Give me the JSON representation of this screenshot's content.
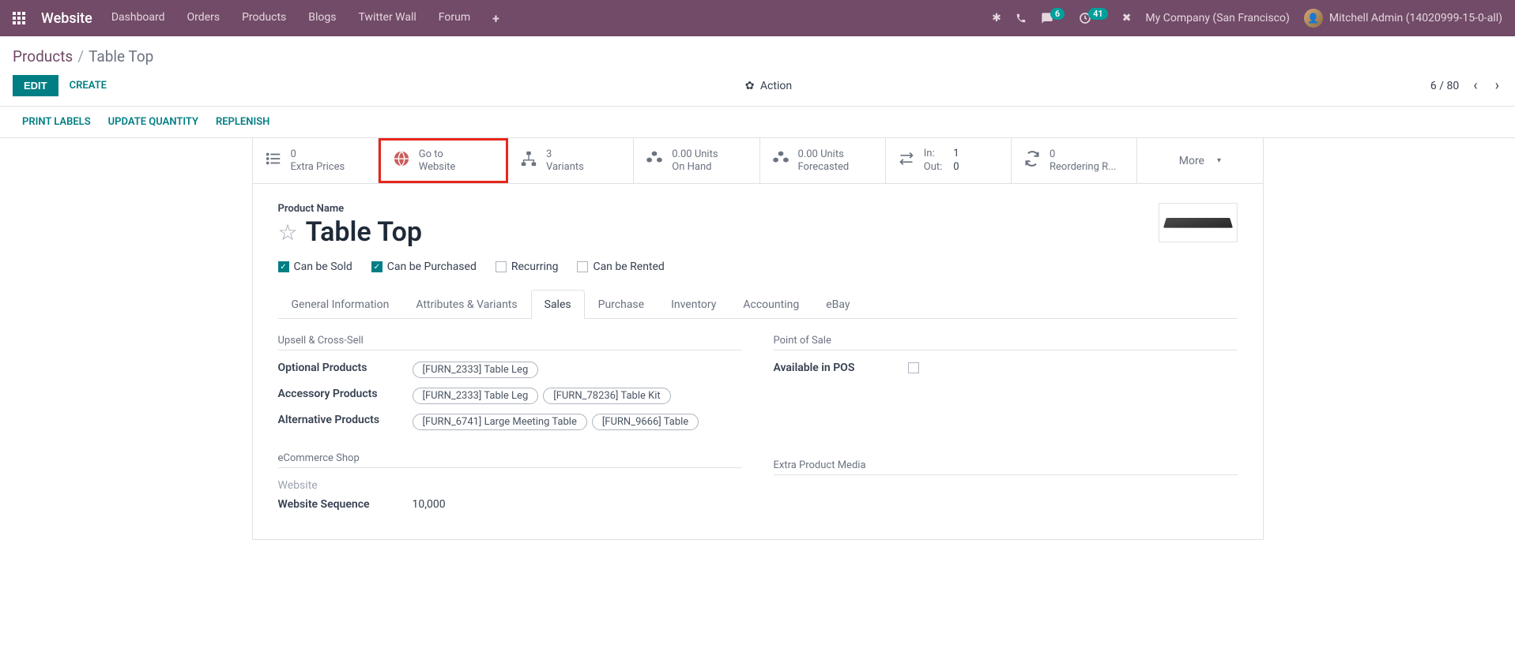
{
  "navbar": {
    "brand": "Website",
    "items": [
      "Dashboard",
      "Orders",
      "Products",
      "Blogs",
      "Twitter Wall",
      "Forum"
    ],
    "messages_badge": "6",
    "activities_badge": "41",
    "company": "My Company (San Francisco)",
    "user": "Mitchell Admin (14020999-15-0-all)"
  },
  "breadcrumb": {
    "parent": "Products",
    "current": "Table Top"
  },
  "controls": {
    "edit": "EDIT",
    "create": "CREATE",
    "action": "Action",
    "pager": "6 / 80"
  },
  "action_links": [
    "PRINT LABELS",
    "UPDATE QUANTITY",
    "REPLENISH"
  ],
  "stats": {
    "extra_prices": {
      "value": "0",
      "label": "Extra Prices"
    },
    "go_to_website": {
      "line1": "Go to",
      "line2": "Website"
    },
    "variants": {
      "value": "3",
      "label": "Variants"
    },
    "on_hand": {
      "value": "0.00 Units",
      "label": "On Hand"
    },
    "forecasted": {
      "value": "0.00 Units",
      "label": "Forecasted"
    },
    "in_out": {
      "in_label": "In:",
      "in_val": "1",
      "out_label": "Out:",
      "out_val": "0"
    },
    "reordering": {
      "value": "0",
      "label": "Reordering R..."
    },
    "more": "More"
  },
  "product": {
    "name_label": "Product Name",
    "name": "Table Top",
    "checks": {
      "can_be_sold": "Can be Sold",
      "can_be_purchased": "Can be Purchased",
      "recurring": "Recurring",
      "can_be_rented": "Can be Rented"
    }
  },
  "tabs": [
    "General Information",
    "Attributes & Variants",
    "Sales",
    "Purchase",
    "Inventory",
    "Accounting",
    "eBay"
  ],
  "sales": {
    "upsell_header": "Upsell & Cross-Sell",
    "optional_label": "Optional Products",
    "optional_tags": [
      "[FURN_2333] Table Leg"
    ],
    "accessory_label": "Accessory Products",
    "accessory_tags": [
      "[FURN_2333] Table Leg",
      "[FURN_78236] Table Kit"
    ],
    "alternative_label": "Alternative Products",
    "alternative_tags": [
      "[FURN_6741] Large Meeting Table",
      "[FURN_9666] Table"
    ],
    "ecommerce_header": "eCommerce Shop",
    "website_label": "Website",
    "website_seq_label": "Website Sequence",
    "website_seq_value": "10,000",
    "pos_header": "Point of Sale",
    "pos_label": "Available in POS",
    "media_header": "Extra Product Media"
  }
}
